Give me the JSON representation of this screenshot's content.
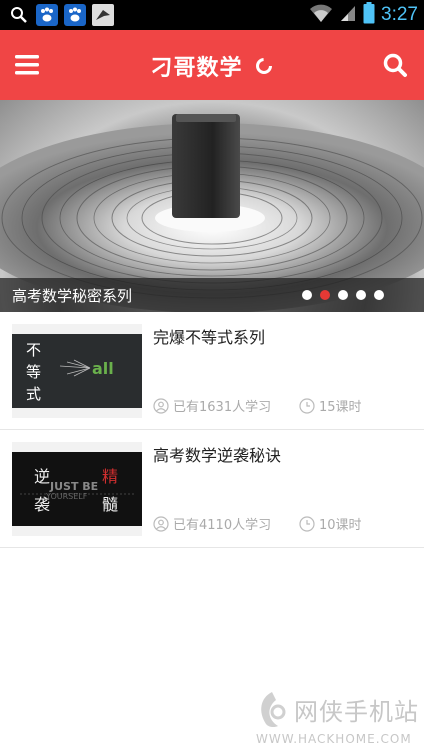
{
  "status_bar": {
    "time": "3:27",
    "icons": [
      "search-icon",
      "baidu-paw-icon",
      "baidu-paw-icon",
      "bird-app-icon",
      "wifi-icon",
      "signal-icon",
      "battery-icon"
    ]
  },
  "app_bar": {
    "title": "刁哥数学",
    "menu_icon": "menu-icon",
    "search_icon": "search-icon",
    "color": "#f04545"
  },
  "banner": {
    "caption": "高考数学秘密系列",
    "dots": 5,
    "active_dot": 2
  },
  "courses": [
    {
      "title": "完爆不等式系列",
      "learners": "已有1631人学习",
      "lessons": "15课时",
      "thumb_chars": [
        "不",
        "等",
        "式"
      ],
      "thumb_word": "all"
    },
    {
      "title": "高考数学逆袭秘诀",
      "learners": "已有4110人学习",
      "lessons": "10课时",
      "thumb_chars": [
        "逆",
        "袭",
        "精",
        "髓"
      ],
      "thumb_words": [
        "JUST BE",
        "YOURSELF"
      ]
    }
  ],
  "watermark": {
    "text": "网侠手机站",
    "url": "WWW.HACKHOME.COM"
  },
  "colors": {
    "accent": "#f04545",
    "active_dot": "#e53935",
    "meta_text": "#aaaaaa"
  }
}
